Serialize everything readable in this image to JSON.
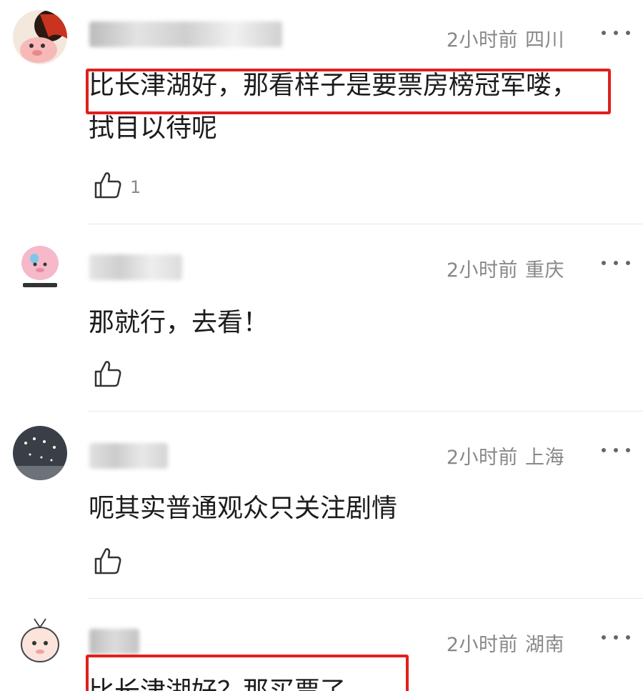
{
  "comments": [
    {
      "time": "2小时前",
      "location": "四川",
      "text_line1": "比长津湖好，那看样子是要票房榜冠军喽，",
      "text_line2": "拭目以待呢",
      "likes": "1",
      "highlighted": true
    },
    {
      "time": "2小时前",
      "location": "重庆",
      "text_line1": "那就行，去看！",
      "text_line2": "",
      "likes": "",
      "highlighted": false
    },
    {
      "time": "2小时前",
      "location": "上海",
      "text_line1": "呃其实普通观众只关注剧情",
      "text_line2": "",
      "likes": "",
      "highlighted": false
    },
    {
      "time": "2小时前",
      "location": "湖南",
      "text_line1": "比长津湖好？那买票了",
      "text_line2": "",
      "likes": "",
      "highlighted": true
    }
  ],
  "icons": {
    "like": "thumbs-up-icon",
    "more": "more-dots-icon"
  },
  "colors": {
    "highlight": "#e0201b",
    "meta_text": "#888888"
  }
}
